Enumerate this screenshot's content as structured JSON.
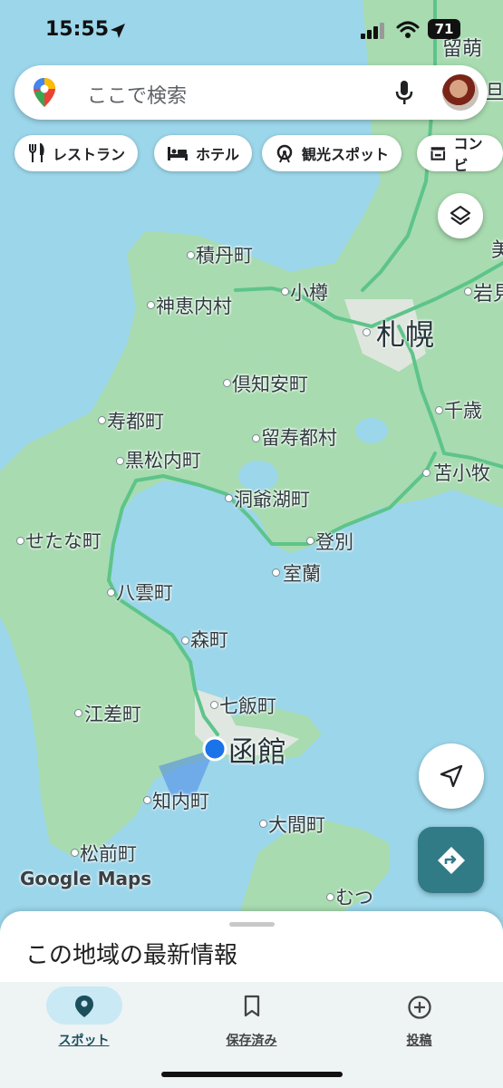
{
  "status_bar": {
    "time": "15:55",
    "battery": "71"
  },
  "search": {
    "placeholder": "ここで検索"
  },
  "chips": [
    {
      "label": "レストラン",
      "icon": "fork-knife-icon"
    },
    {
      "label": "ホテル",
      "icon": "bed-icon"
    },
    {
      "label": "観光スポット",
      "icon": "ferris-wheel-icon"
    },
    {
      "label": "コンビ",
      "icon": "store-icon"
    }
  ],
  "map": {
    "places": {
      "rumoi": "留萌",
      "shakotan": "積丹町",
      "kamoenai": "神恵内村",
      "otaru": "小樽",
      "sapporo": "札幌",
      "kutchan": "倶知安町",
      "suttsu": "寿都町",
      "rusutsu": "留寿都村",
      "chitose": "千歳",
      "kuromatsunai": "黒松内町",
      "tomakomai": "苫小牧",
      "toyako": "洞爺湖町",
      "setana": "せたな町",
      "noboribetsu": "登別",
      "muroran": "室蘭",
      "yakumo": "八雲町",
      "mori": "森町",
      "nanae": "七飯町",
      "esashi": "江差町",
      "hakodate": "函館",
      "shiriuchi": "知内町",
      "oma": "大間町",
      "matsumae": "松前町",
      "mutsu": "むつ",
      "edge_right_1": "旦",
      "edge_right_2": "美",
      "edge_right_3": "岩見"
    },
    "attribution": "Google Maps",
    "colors": {
      "water": "#9cd6ea",
      "land": "#a8dbb0",
      "road": "#5dc48a",
      "location": "#1a73e8",
      "direction_button": "#317b87"
    }
  },
  "sheet": {
    "title": "この地域の最新情報"
  },
  "nav": [
    {
      "label": "スポット",
      "icon": "pin-icon",
      "active": true
    },
    {
      "label": "保存済み",
      "icon": "bookmark-icon",
      "active": false
    },
    {
      "label": "投稿",
      "icon": "add-circle-icon",
      "active": false
    }
  ]
}
